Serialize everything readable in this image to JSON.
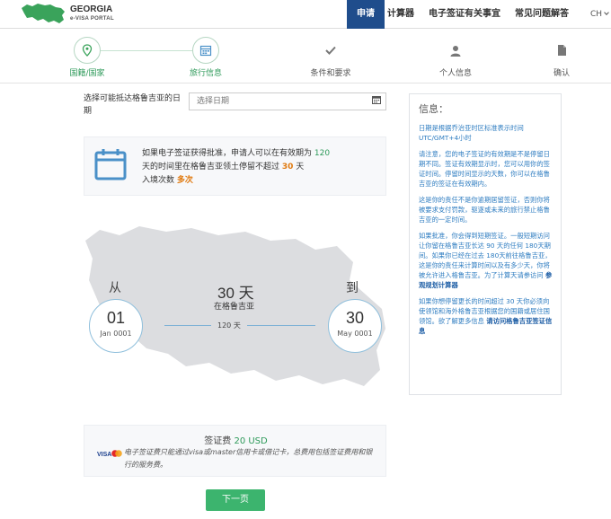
{
  "header": {
    "logo_title": "GEORGIA",
    "logo_subtitle": "e-VISA PORTAL",
    "nav": [
      {
        "label": "申请",
        "active": true
      },
      {
        "label": "计算器",
        "active": false
      },
      {
        "label": "电子签证有关事宜",
        "active": false
      },
      {
        "label": "常见问题解答",
        "active": false
      }
    ],
    "language": "CH"
  },
  "steps": [
    {
      "label": "国籍/国家",
      "icon": "map-pin-icon",
      "state": "done"
    },
    {
      "label": "旅行信息",
      "icon": "calendar-icon",
      "state": "current"
    },
    {
      "label": "条件和要求",
      "icon": "check-icon",
      "state": "pending"
    },
    {
      "label": "个人信息",
      "icon": "person-icon",
      "state": "pending"
    },
    {
      "label": "确认",
      "icon": "document-icon",
      "state": "pending"
    }
  ],
  "form": {
    "date_label": "选择可能抵达格鲁吉亚的日期",
    "date_placeholder": "选择日期"
  },
  "visa_notice": {
    "part1": "如果电子签证获得批准，申请人可以在有效期为",
    "validity_days": "120",
    "part2": "天的时间里在格鲁吉亚领土停留不超过",
    "stay_days": "30",
    "part3": "天",
    "part4": "入境次数",
    "entries": "多次"
  },
  "range": {
    "from_label": "从",
    "from_day": "01",
    "from_month": "Jan 0001",
    "days": "30 天",
    "in_country": "在格鲁吉亚",
    "validity": "120 天",
    "to_label": "到",
    "to_day": "30",
    "to_month": "May 0001"
  },
  "fee": {
    "label": "签证费",
    "amount": "20 USD",
    "note": "电子签证费只能通过visa或master信用卡或借记卡，总费用包括签证费用和银行的服务费。"
  },
  "next_button": "下一页",
  "info": {
    "title": "信息：",
    "p1": "日期是根据乔治亚时区标准表示时间UTC/GMT+4小时",
    "p2": "请注意，您的电子签证的有效期是不是停留日期不同。签证有效期显示时，您可以用你的签证时间。停留时间显示的天数，你可以在格鲁吉亚的签证在有效期内。",
    "p3": "这是你的责任不是你逾期居留签证，否则你将被要求支付罚款，驱逐或未来的旅行禁止格鲁吉亚的一定时间。",
    "p4a": "如果批准，你会得到短期签证。一般短期访问让你留在格鲁吉亚长达 90 天的任何 180天期间。如果你已经在过去 180天前往格鲁吉亚，这是你的责任来计算时间以及有多少天，你将被允许进入格鲁吉亚。为了计算天请参访问",
    "p4_link": "参观规划计算器",
    "p5a": "如果你想停留更长的时间超过 30 天你必须向使领馆和海外格鲁吉亚根据您的国籍或居住国领馆。欲了解更多信息",
    "p5_link": "请访问格鲁吉亚签证信息"
  },
  "colors": {
    "nav_active": "#1f4d8c",
    "accent_green": "#3cb46e",
    "info_text": "#2f7dc1",
    "highlight_orange": "#e07a10"
  }
}
